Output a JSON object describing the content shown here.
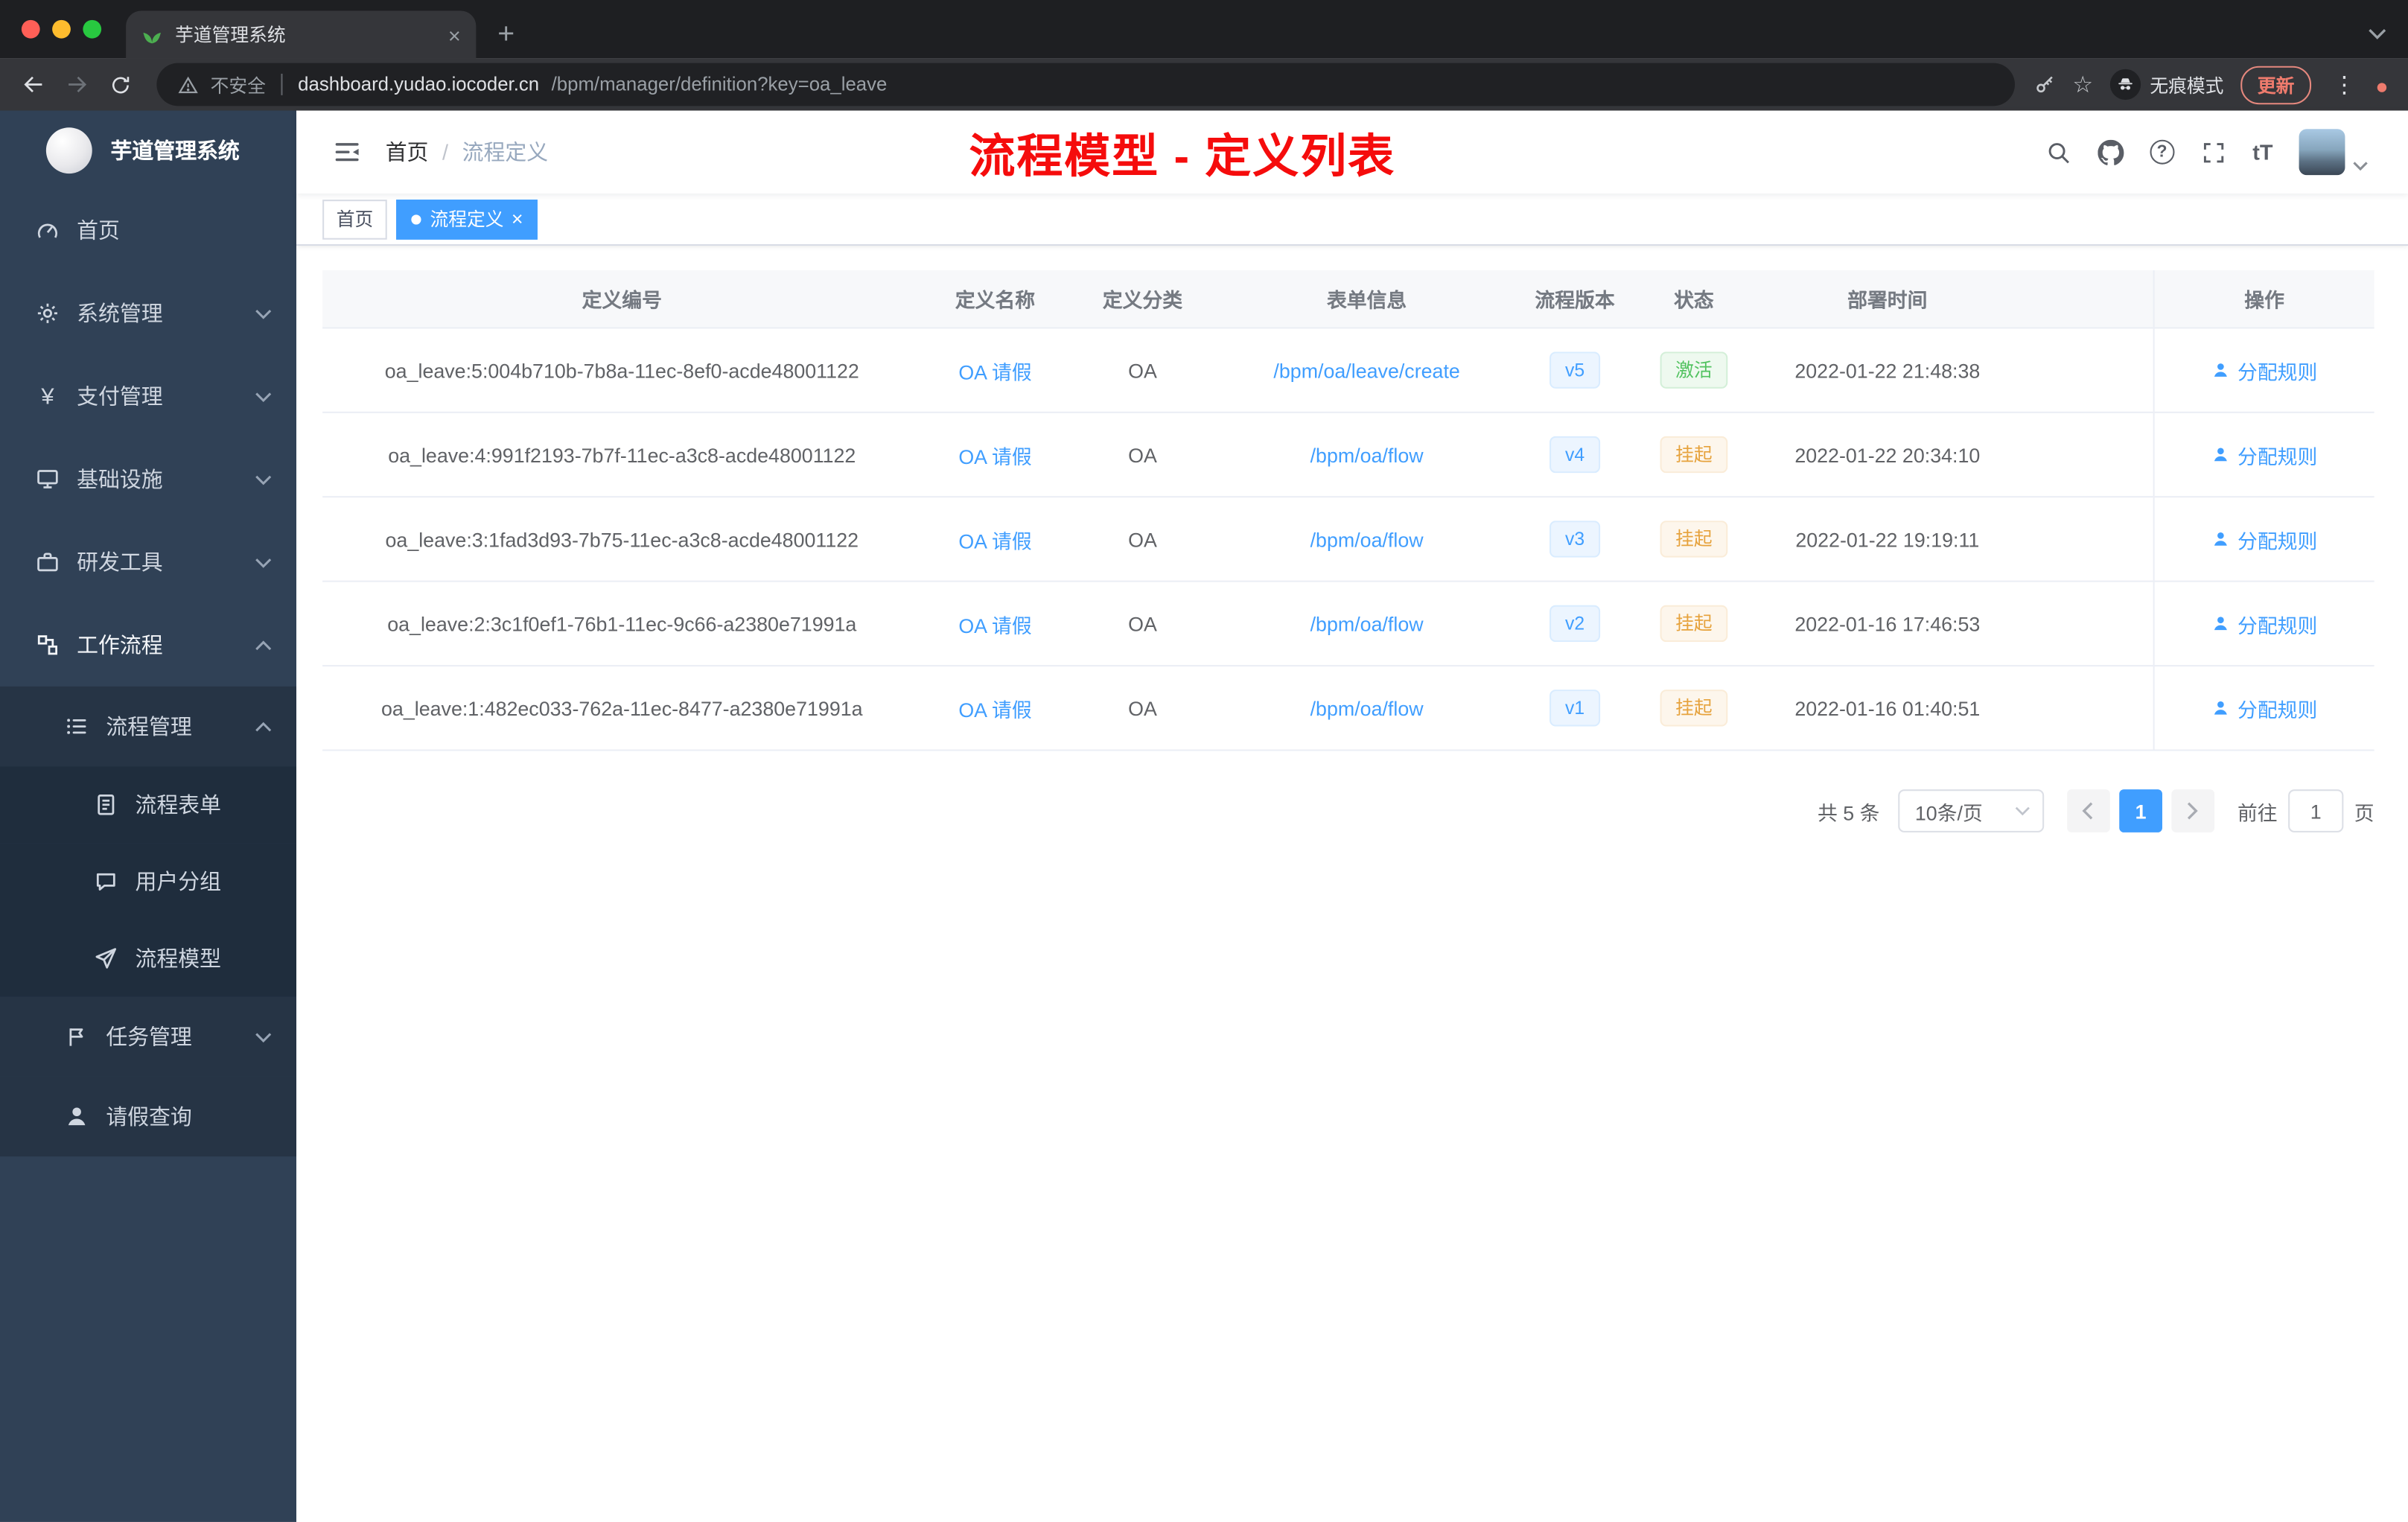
{
  "browser": {
    "tab_title": "芋道管理系统",
    "address": {
      "security_label": "不安全",
      "host": "dashboard.yudao.iocoder.cn",
      "path": "/bpm/manager/definition?key=oa_leave"
    },
    "incognito_label": "无痕模式",
    "update_label": "更新"
  },
  "icons": {
    "star": "☆",
    "kebab": "⋮",
    "close": "×",
    "plus": "+",
    "question": "?",
    "text_size": "tT",
    "yen": "¥"
  },
  "sidebar": {
    "logo_title": "芋道管理系统",
    "items": [
      {
        "label": "首页"
      },
      {
        "label": "系统管理"
      },
      {
        "label": "支付管理"
      },
      {
        "label": "基础设施"
      },
      {
        "label": "研发工具"
      },
      {
        "label": "工作流程"
      },
      {
        "label": "流程管理"
      },
      {
        "label": "流程表单"
      },
      {
        "label": "用户分组"
      },
      {
        "label": "流程模型"
      },
      {
        "label": "任务管理"
      },
      {
        "label": "请假查询"
      }
    ]
  },
  "header": {
    "breadcrumb": {
      "home": "首页",
      "separator": "/",
      "current": "流程定义"
    },
    "overlay_title": "流程模型 - 定义列表"
  },
  "tags": {
    "home": "首页",
    "active": "流程定义"
  },
  "table": {
    "columns": [
      "定义编号",
      "定义名称",
      "定义分类",
      "表单信息",
      "流程版本",
      "状态",
      "部署时间",
      "操作"
    ],
    "rows": [
      {
        "id": "oa_leave:5:004b710b-7b8a-11ec-8ef0-acde48001122",
        "name": "OA 请假",
        "category": "OA",
        "form": "/bpm/oa/leave/create",
        "version": "v5",
        "status": "激活",
        "time": "2022-01-22 21:48:38",
        "action": "分配规则"
      },
      {
        "id": "oa_leave:4:991f2193-7b7f-11ec-a3c8-acde48001122",
        "name": "OA 请假",
        "category": "OA",
        "form": "/bpm/oa/flow",
        "version": "v4",
        "status": "挂起",
        "time": "2022-01-22 20:34:10",
        "action": "分配规则"
      },
      {
        "id": "oa_leave:3:1fad3d93-7b75-11ec-a3c8-acde48001122",
        "name": "OA 请假",
        "category": "OA",
        "form": "/bpm/oa/flow",
        "version": "v3",
        "status": "挂起",
        "time": "2022-01-22 19:19:11",
        "action": "分配规则"
      },
      {
        "id": "oa_leave:2:3c1f0ef1-76b1-11ec-9c66-a2380e71991a",
        "name": "OA 请假",
        "category": "OA",
        "form": "/bpm/oa/flow",
        "version": "v2",
        "status": "挂起",
        "time": "2022-01-16 17:46:53",
        "action": "分配规则"
      },
      {
        "id": "oa_leave:1:482ec033-762a-11ec-8477-a2380e71991a",
        "name": "OA 请假",
        "category": "OA",
        "form": "/bpm/oa/flow",
        "version": "v1",
        "status": "挂起",
        "time": "2022-01-16 01:40:51",
        "action": "分配规则"
      }
    ]
  },
  "pagination": {
    "total": "共 5 条",
    "page_size": "10条/页",
    "current_page": "1",
    "goto_label": "前往",
    "goto_value": "1",
    "page_unit": "页"
  },
  "colors": {
    "accent": "#409EFF",
    "success": "#67C23A",
    "warning": "#E6A23C",
    "title_red": "#F50C0C",
    "sidebar": "#304156"
  }
}
